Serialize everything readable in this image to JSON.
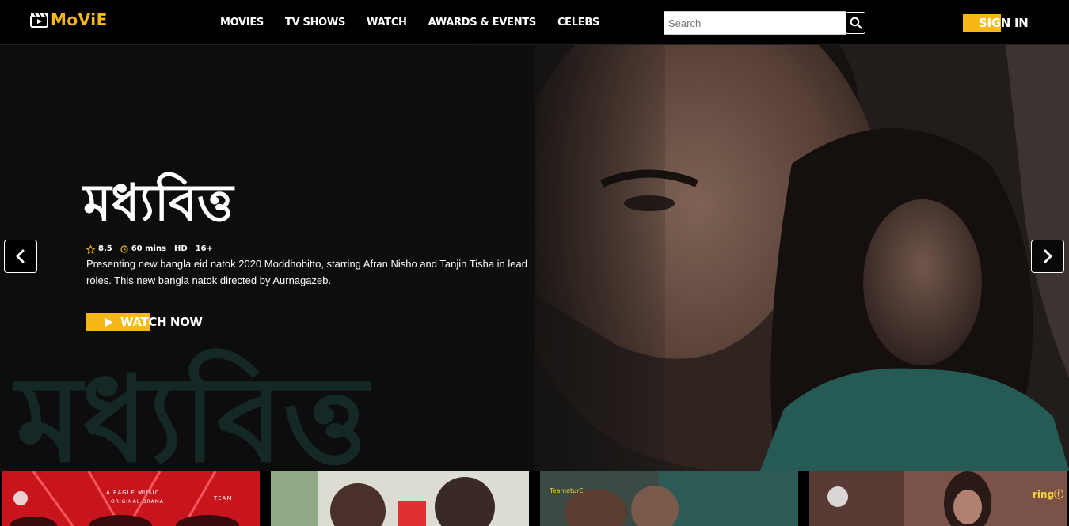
{
  "header": {
    "logo_text": "MoViE",
    "nav": [
      "MOVIES",
      "TV SHOWS",
      "WATCH",
      "AWARDS & EVENTS",
      "CELEBS"
    ],
    "search_placeholder": "Search",
    "signin_label": "SIGN IN"
  },
  "hero": {
    "title": "মধ্যবিত্ত",
    "watermark": "মধ্যবিত্ত",
    "rating": "8.5",
    "duration": "60 mins",
    "quality": "HD",
    "age": "16+",
    "description": "Presenting new bangla eid natok 2020 Moddhobitto, starring Afran Nisho and Tanjin Tisha in lead roles. This new bangla natok directed by Aurnagazeb.",
    "watch_label": "WATCH NOW"
  },
  "thumbs": {
    "t1_line1": "A EAGLE MUSIC",
    "t1_line2": "ORIGINAL DRAMA",
    "t1_tag": "TEAM",
    "t3_tag": "TeamaturE",
    "t4_tag": "ringⓕ"
  },
  "colors": {
    "accent": "#f5b816",
    "header_bg": "#000000",
    "hero_bg": "#131313"
  },
  "icons": {
    "logo": "clapperboard-icon",
    "search": "search-icon",
    "rating": "star-icon",
    "duration": "clock-icon",
    "watch": "play-icon",
    "prev": "chevron-left-icon",
    "next": "chevron-right-icon"
  }
}
